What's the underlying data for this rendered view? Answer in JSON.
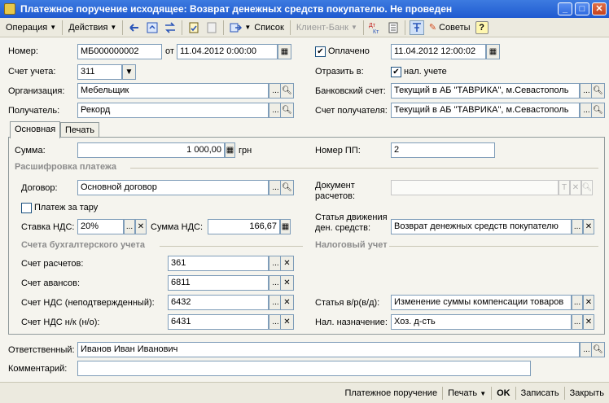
{
  "window": {
    "title": "Платежное поручение исходящее: Возврат денежных средств покупателю. Не проведен"
  },
  "toolbar": {
    "operation": "Операция",
    "actions": "Действия",
    "list": "Список",
    "client_bank": "Клиент-Банк",
    "tips": "Советы",
    "help": "?"
  },
  "header": {
    "number_label": "Номер:",
    "number": "МБ000000002",
    "from_label": "от",
    "date": "11.04.2012  0:00:00",
    "paid_label": "Оплачено",
    "paid_date": "11.04.2012 12:00:02",
    "paid_checked": true,
    "account_label": "Счет учета:",
    "account": "311",
    "reflect_label": "Отразить в:",
    "tax_label": "нал. учете",
    "tax_checked": true,
    "org_label": "Организация:",
    "org": "Мебельщик",
    "bank_label": "Банковский счет:",
    "bank": "Текущий в АБ \"ТАВРИКА\", м.Севастополь",
    "recipient_label": "Получатель:",
    "recipient": "Рекорд",
    "recipient_acc_label": "Счет получателя:",
    "recipient_acc": "Текущий в АБ \"ТАВРИКА\", м.Севастополь"
  },
  "tabs": {
    "main": "Основная",
    "print": "Печать"
  },
  "main": {
    "sum_label": "Сумма:",
    "sum": "1 000,00",
    "currency": "грн",
    "pp_label": "Номер ПП:",
    "pp": "2",
    "breakdown": "Расшифровка платежа",
    "contract_label": "Договор:",
    "contract": "Основной договор",
    "doc_label_1": "Документ",
    "doc_label_2": "расчетов:",
    "doc": "",
    "tare_label": "Платеж за тару",
    "tare_checked": false,
    "vat_rate_label": "Ставка НДС:",
    "vat_rate": "20%",
    "vat_sum_label": "Сумма НДС:",
    "vat_sum": "166,67",
    "cashflow_label_1": "Статья движения",
    "cashflow_label_2": "ден. средств:",
    "cashflow": "Возврат денежных средств покупателю",
    "accounts_section": "Счета бухгалтерского учета",
    "tax_section": "Налоговый учет",
    "settle_label": "Счет расчетов:",
    "settle": "361",
    "advance_label": "Счет авансов:",
    "advance": "6811",
    "vat_unconf_label": "Счет НДС (неподтвержденный):",
    "vat_unconf": "6432",
    "vat_nk_label": "Счет НДС н/к (н/о):",
    "vat_nk": "6431",
    "article_label": "Статья в/р(в/д):",
    "article": "Изменение суммы компенсации товаров",
    "purpose_label": "Нал. назначение:",
    "purpose": "Хоз. д-сть"
  },
  "footer": {
    "resp_label": "Ответственный:",
    "resp": "Иванов Иван Иванович",
    "comment_label": "Комментарий:",
    "comment": ""
  },
  "bottom": {
    "payment_order": "Платежное поручение",
    "print": "Печать",
    "ok": "OK",
    "save": "Записать",
    "close": "Закрыть"
  }
}
